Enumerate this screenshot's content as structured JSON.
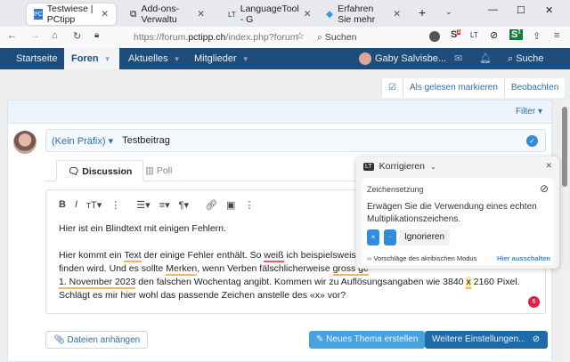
{
  "browser": {
    "tabs": [
      {
        "label": "Testwiese | PCtipp",
        "icon": "pctipp-icon"
      },
      {
        "label": "Add-ons-Verwaltu",
        "icon": "puzzle-icon"
      },
      {
        "label": "LanguageTool - G",
        "icon": "languagetool-icon"
      },
      {
        "label": "Erfahren Sie mehr",
        "icon": "shield-icon"
      }
    ],
    "url_prefix": "https://forum.",
    "url_domain": "pctipp.ch",
    "url_suffix": "/index.php?forum",
    "search_placeholder": "Suchen",
    "ext_badge1": "1",
    "ext_badge2": "1"
  },
  "nav": {
    "items": [
      "Startseite",
      "Foren",
      "Aktuelles",
      "Mitglieder"
    ],
    "user": "Gaby Salvisbe...",
    "search": "Suche"
  },
  "actions": {
    "mark_read": "Als gelesen markieren",
    "watch": "Beobachten"
  },
  "filter": "Filter",
  "thread": {
    "prefix": "(Kein Präfix)",
    "title": "Testbeitrag",
    "tabs": [
      "Discussion",
      "Poll"
    ]
  },
  "editor": {
    "p1": "Hier ist ein Blindtext mit einigen Fehlern.",
    "l1a": "Hier kommt ein ",
    "l1b": "Text",
    "l1c": " der einige Fehler enthält. So ",
    "l1d": "weiß",
    "l1e": " ich beispielsweise,",
    "l2a": "finden wird. Und es sollte ",
    "l2b": "Merken",
    "l2c": ", wenn Verben fälschlicherweise ",
    "l2d": "gross ge",
    "l3a": "1. November 2023",
    "l3b": " den falschen Wochentag angibt. Kommen wir zu Auflösungsangaben wie 3840 ",
    "l3c": "x",
    "l3d": " 2160 Pixel.",
    "l4": "Schlägt es mir hier wohl das passende Zeichen anstelle des «x» vor?",
    "error_count": "6"
  },
  "buttons": {
    "attach": "Dateien anhängen",
    "new_thread": "Neues Thema erstellen",
    "more": "Weitere Einstellungen..."
  },
  "popup": {
    "title": "Korrigieren",
    "category": "Zeichensetzung",
    "message": "Erwägen Sie die Verwendung eines echten Multiplikationszeichens.",
    "suggestions": [
      "×",
      "·"
    ],
    "ignore": "Ignorieren",
    "picky": "Vorschläge des akribischen Modus",
    "disable": "Hier ausschalten"
  }
}
